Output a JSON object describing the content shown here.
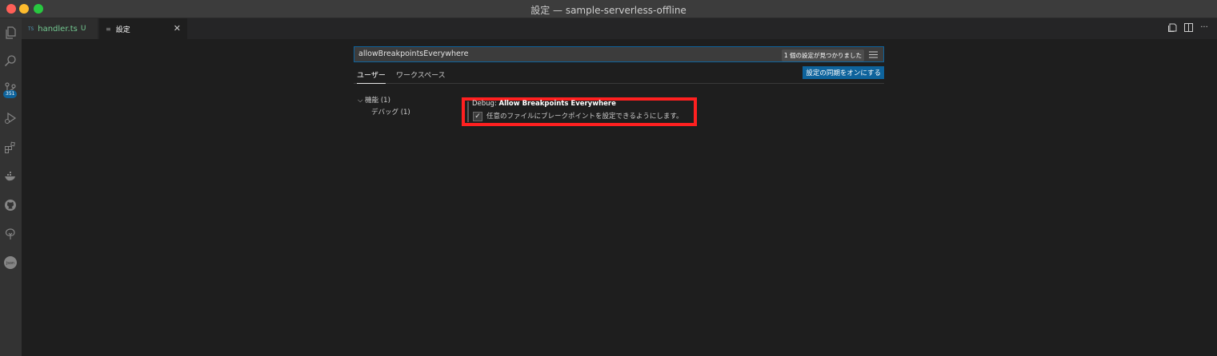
{
  "window": {
    "title": "設定 — sample-serverless-offline"
  },
  "activity_bar": {
    "items": [
      {
        "icon": "explorer-icon"
      },
      {
        "icon": "search-icon"
      },
      {
        "icon": "source-control-icon",
        "badge": "351"
      },
      {
        "icon": "run-debug-icon"
      },
      {
        "icon": "extensions-icon"
      },
      {
        "icon": "docker-icon"
      },
      {
        "icon": "github-icon"
      },
      {
        "icon": "tree-icon"
      },
      {
        "icon": "json-icon"
      }
    ]
  },
  "tabs": [
    {
      "prefix": "TS",
      "label": "handler.ts",
      "status": "U"
    },
    {
      "label": "設定",
      "active": true
    }
  ],
  "settings": {
    "search_value": "allowBreakpointsEverywhere",
    "result_count": "1 個の設定が見つかりました",
    "scope_tabs": {
      "user": "ユーザー",
      "workspace": "ワークスペース"
    },
    "sync_button": "設定の同期をオンにする",
    "toc": {
      "feature": "機能 (1)",
      "debug": "デバッグ (1)"
    },
    "setting": {
      "category": "Debug: ",
      "key": "Allow Breakpoints Everywhere",
      "description": "任意のファイルにブレークポイントを設定できるようにします。",
      "checked": true
    }
  },
  "colors": {
    "accent": "#0e639c",
    "highlight": "#ff2020",
    "modified": "#73c991"
  }
}
